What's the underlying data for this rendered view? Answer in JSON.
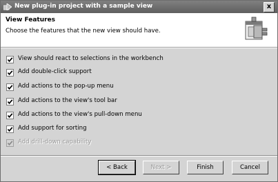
{
  "window": {
    "title": "New plug-in project with a sample view",
    "close_label": "x",
    "title_icon": "plugin-wizard-icon"
  },
  "header": {
    "title": "View Features",
    "description": "Choose the features that the new view should have.",
    "icon": "wizard-banner-icon"
  },
  "options": [
    {
      "label": "View should react to selections in the workbench",
      "checked": true,
      "enabled": true
    },
    {
      "label": "Add double-click support",
      "checked": true,
      "enabled": true
    },
    {
      "label": "Add actions to the pop-up menu",
      "checked": true,
      "enabled": true
    },
    {
      "label": "Add actions to the view's tool bar",
      "checked": true,
      "enabled": true
    },
    {
      "label": "Add actions to the view's pull-down menu",
      "checked": true,
      "enabled": true
    },
    {
      "label": "Add support for sorting",
      "checked": true,
      "enabled": true
    },
    {
      "label": "Add drill-down capability",
      "checked": true,
      "enabled": false
    }
  ],
  "buttons": {
    "back": "< Back",
    "next": "Next >",
    "finish": "Finish",
    "cancel": "Cancel"
  }
}
